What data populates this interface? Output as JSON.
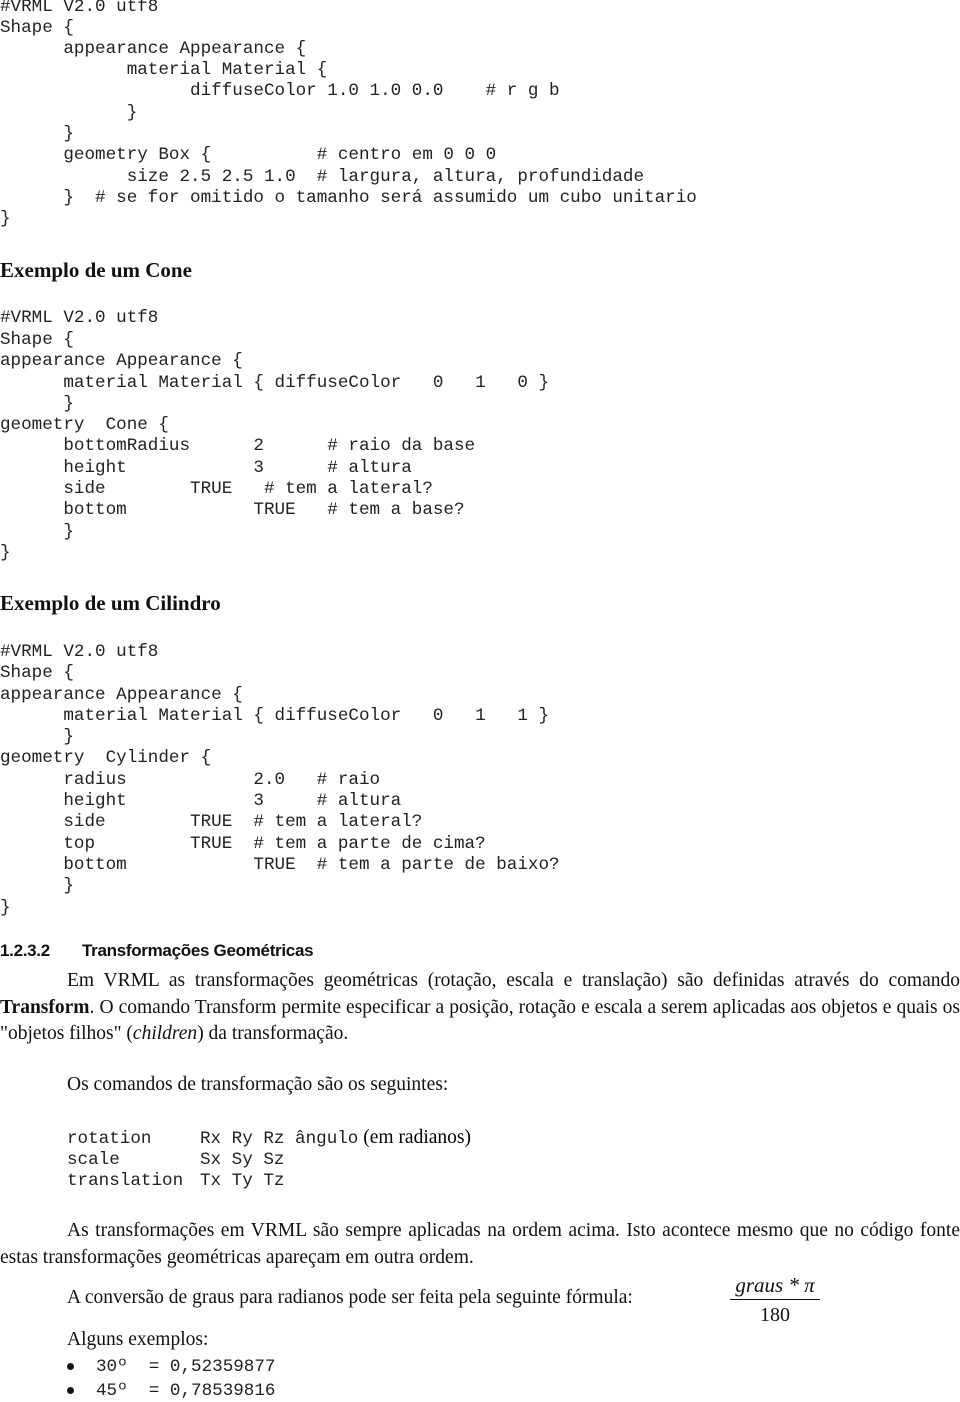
{
  "box_example": {
    "code_lines": [
      "#VRML V2.0 utf8",
      "Shape {",
      "      appearance Appearance {",
      "            material Material {",
      "                  diffuseColor 1.0 1.0 0.0    # r g b",
      "            }",
      "      }",
      "      geometry Box {          # centro em 0 0 0",
      "            size 2.5 2.5 1.0  # largura, altura, profundidade",
      "      }  # se for omitido o tamanho será assumido um cubo unitario",
      "}"
    ]
  },
  "cone_example": {
    "heading": "Exemplo de um Cone",
    "code_lines": [
      "#VRML V2.0 utf8",
      "Shape {",
      "appearance Appearance {",
      "      material Material { diffuseColor   0   1   0 }",
      "      }",
      "geometry  Cone {",
      "      bottomRadius      2      # raio da base",
      "      height            3      # altura",
      "      side        TRUE   # tem a lateral?",
      "      bottom            TRUE   # tem a base?",
      "      }",
      "}"
    ]
  },
  "cylinder_example": {
    "heading": "Exemplo de um Cilindro",
    "code_lines": [
      "#VRML V2.0 utf8",
      "Shape {",
      "appearance Appearance {",
      "      material Material { diffuseColor   0   1   1 }",
      "      }",
      "geometry  Cylinder {",
      "      radius            2.0   # raio",
      "      height            3     # altura",
      "      side        TRUE  # tem a lateral?",
      "      top         TRUE  # tem a parte de cima?",
      "      bottom            TRUE  # tem a parte de baixo?",
      "      }",
      "}"
    ]
  },
  "section": {
    "number": "1.2.3.2",
    "title": "Transformações Geométricas",
    "intro_part1": "Em VRML as transformações geométricas (rotação, escala e translação) são definidas através do comando ",
    "intro_bold": "Transform",
    "intro_part2": ". O comando Transform permite especificar a posição, rotação e escala a serem aplicadas aos objetos e quais os \"objetos filhos\" (",
    "intro_italic": "children",
    "intro_part3": ") da transformação.",
    "commands_intro": "Os comandos de transformação são os seguintes:",
    "commands": [
      {
        "name": "rotation",
        "args": "Rx Ry Rz ângulo",
        "note": " (em radianos)"
      },
      {
        "name": "scale",
        "args": "Sx Sy Sz",
        "note": ""
      },
      {
        "name": "translation",
        "args": "Tx Ty Tz",
        "note": ""
      }
    ],
    "order_text": "As transformações em VRML são sempre aplicadas na ordem acima. Isto acontece mesmo que no código fonte estas transformações geométricas apareçam em outra ordem.",
    "conversion_text": "A conversão de graus para radianos pode ser feita pela seguinte fórmula:",
    "formula_numerator": "graus * π",
    "formula_denominator": "180",
    "examples_heading": "Alguns exemplos:",
    "examples": [
      "30º  = 0,52359877",
      "45º  = 0,78539816"
    ]
  }
}
